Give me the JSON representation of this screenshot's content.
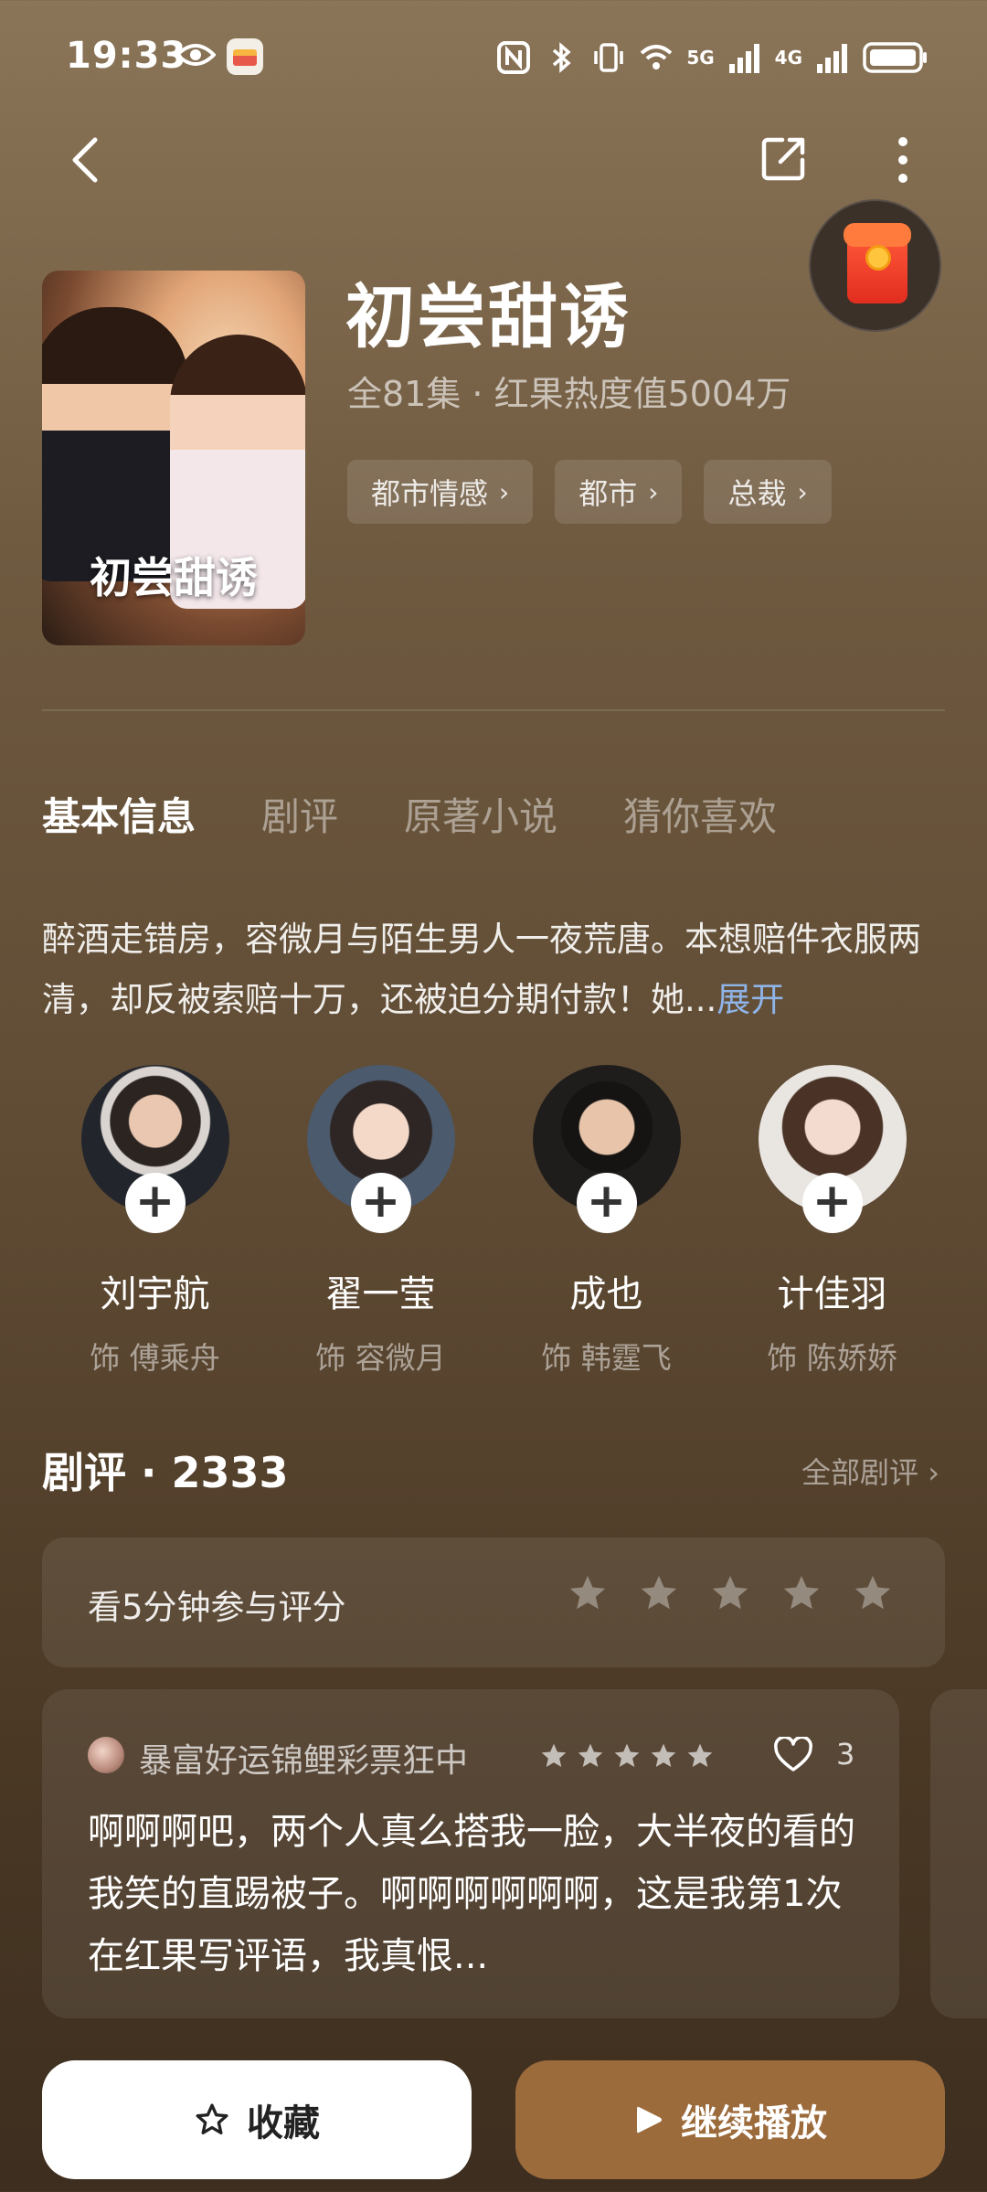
{
  "status": {
    "time": "19:33",
    "network1": "5G",
    "network2": "4G"
  },
  "show": {
    "title": "初尝甜诱",
    "poster_title": "初尝甜诱",
    "meta": "全81集 · 红果热度值5004万",
    "tags": [
      "都市情感",
      "都市",
      "总裁"
    ]
  },
  "tabs": [
    "基本信息",
    "剧评",
    "原著小说",
    "猜你喜欢"
  ],
  "synopsis": {
    "text": "醉酒走错房，容微月与陌生男人一夜荒唐。本想赔件衣服两清，却反被索赔十万，还被迫分期付款！她...",
    "expand": "展开"
  },
  "cast": [
    {
      "name": "刘宇航",
      "role": "饰 傅乘舟"
    },
    {
      "name": "翟一莹",
      "role": "饰 容微月"
    },
    {
      "name": "成也",
      "role": "饰 韩霆飞"
    },
    {
      "name": "计佳羽",
      "role": "饰 陈娇娇"
    }
  ],
  "reviews": {
    "title": "剧评 · 2333",
    "all_link": "全部剧评",
    "rate_prompt": "看5分钟参与评分",
    "card": {
      "user": "暴富好运锦鲤彩票狂中",
      "likes": "3",
      "text": "啊啊啊吧，两个人真么搭我一脸，大半夜的看的我笑的直踢被子。啊啊啊啊啊啊，这是我第1次在红果写评语，我真恨..."
    }
  },
  "buttons": {
    "favorite": "收藏",
    "continue": "继续播放"
  },
  "colors": {
    "accent": "#9c6b3c",
    "link": "#8fb4e8"
  }
}
